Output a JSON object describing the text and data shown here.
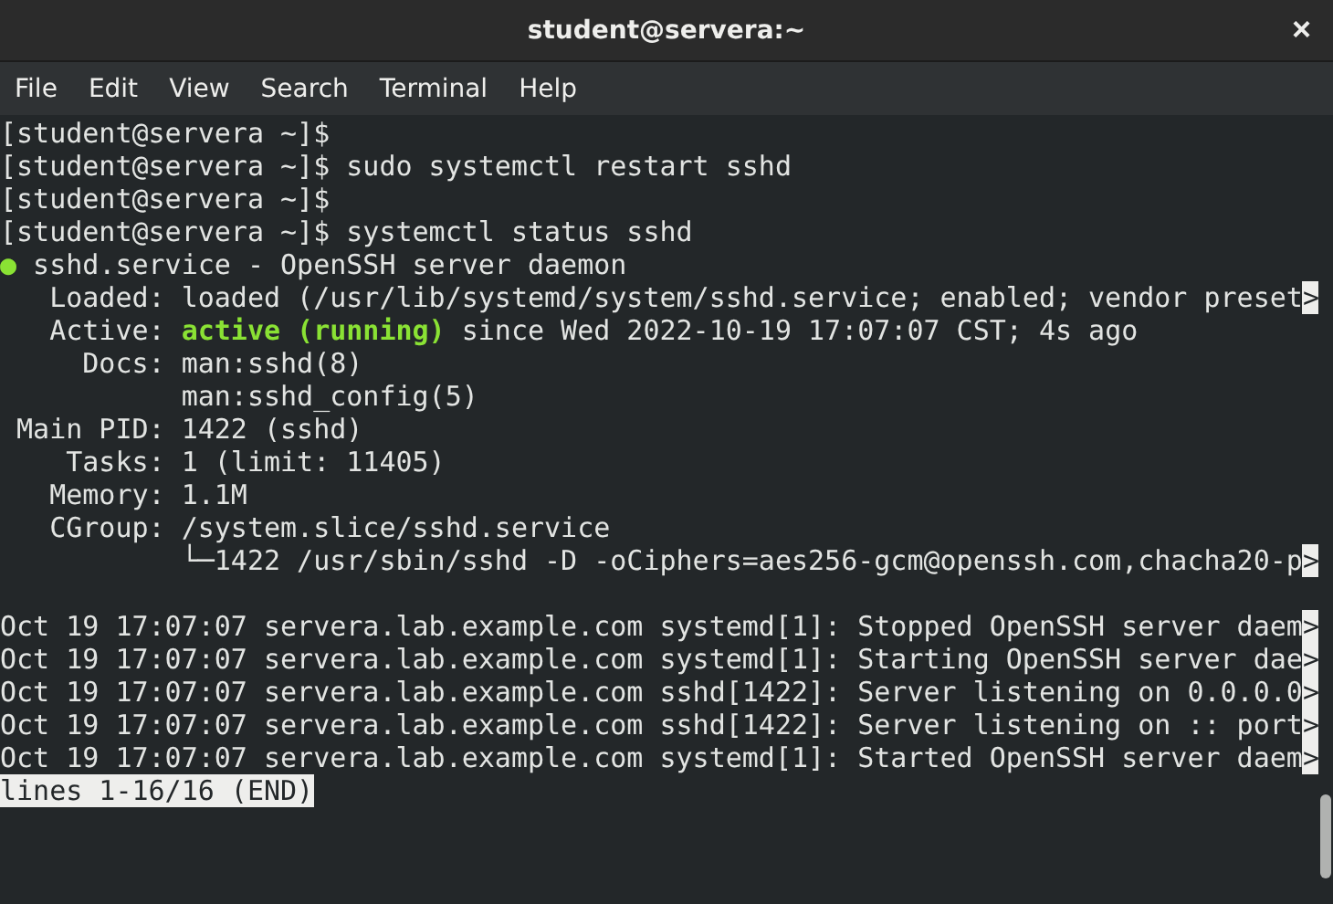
{
  "window": {
    "title": "student@servera:~",
    "close": "×"
  },
  "menu": [
    "File",
    "Edit",
    "View",
    "Search",
    "Terminal",
    "Help"
  ],
  "lines": [
    {
      "segments": [
        {
          "kind": "plain",
          "text": "[student@servera ~]$"
        }
      ]
    },
    {
      "segments": [
        {
          "kind": "plain",
          "text": "[student@servera ~]$ sudo systemctl restart sshd"
        }
      ]
    },
    {
      "segments": [
        {
          "kind": "plain",
          "text": "[student@servera ~]$"
        }
      ]
    },
    {
      "segments": [
        {
          "kind": "plain",
          "text": "[student@servera ~]$ systemctl status sshd"
        }
      ]
    },
    {
      "segments": [
        {
          "kind": "dot",
          "text": "●"
        },
        {
          "kind": "plain",
          "text": " sshd.service - OpenSSH server daemon"
        }
      ]
    },
    {
      "segments": [
        {
          "kind": "plain",
          "text": "   Loaded: loaded (/usr/lib/systemd/system/sshd.service; enabled; vendor preset"
        },
        {
          "kind": "reverse",
          "text": ">"
        }
      ]
    },
    {
      "segments": [
        {
          "kind": "plain",
          "text": "   Active: "
        },
        {
          "kind": "highlight",
          "text": "active (running)"
        },
        {
          "kind": "plain",
          "text": " since Wed 2022-10-19 17:07:07 CST; 4s ago"
        }
      ]
    },
    {
      "segments": [
        {
          "kind": "plain",
          "text": "     Docs: man:sshd(8)"
        }
      ]
    },
    {
      "segments": [
        {
          "kind": "plain",
          "text": "           man:sshd_config(5)"
        }
      ]
    },
    {
      "segments": [
        {
          "kind": "plain",
          "text": " Main PID: 1422 (sshd)"
        }
      ]
    },
    {
      "segments": [
        {
          "kind": "plain",
          "text": "    Tasks: 1 (limit: 11405)"
        }
      ]
    },
    {
      "segments": [
        {
          "kind": "plain",
          "text": "   Memory: 1.1M"
        }
      ]
    },
    {
      "segments": [
        {
          "kind": "plain",
          "text": "   CGroup: /system.slice/sshd.service"
        }
      ]
    },
    {
      "segments": [
        {
          "kind": "plain",
          "text": "           └─1422 /usr/sbin/sshd -D -oCiphers=aes256-gcm@openssh.com,chacha20-p"
        },
        {
          "kind": "reverse",
          "text": ">"
        }
      ]
    },
    {
      "kind": "blank"
    },
    {
      "segments": [
        {
          "kind": "plain",
          "text": "Oct 19 17:07:07 servera.lab.example.com systemd[1]: Stopped OpenSSH server daem"
        },
        {
          "kind": "reverse",
          "text": ">"
        }
      ]
    },
    {
      "segments": [
        {
          "kind": "plain",
          "text": "Oct 19 17:07:07 servera.lab.example.com systemd[1]: Starting OpenSSH server dae"
        },
        {
          "kind": "reverse",
          "text": ">"
        }
      ]
    },
    {
      "segments": [
        {
          "kind": "plain",
          "text": "Oct 19 17:07:07 servera.lab.example.com sshd[1422]: Server listening on 0.0.0.0"
        },
        {
          "kind": "reverse",
          "text": ">"
        }
      ]
    },
    {
      "segments": [
        {
          "kind": "plain",
          "text": "Oct 19 17:07:07 servera.lab.example.com sshd[1422]: Server listening on :: port"
        },
        {
          "kind": "reverse",
          "text": ">"
        }
      ]
    },
    {
      "segments": [
        {
          "kind": "plain",
          "text": "Oct 19 17:07:07 servera.lab.example.com systemd[1]: Started OpenSSH server daem"
        },
        {
          "kind": "reverse",
          "text": ">"
        }
      ]
    },
    {
      "segments": [
        {
          "kind": "reverse",
          "text": "lines 1-16/16 (END)"
        }
      ]
    }
  ]
}
